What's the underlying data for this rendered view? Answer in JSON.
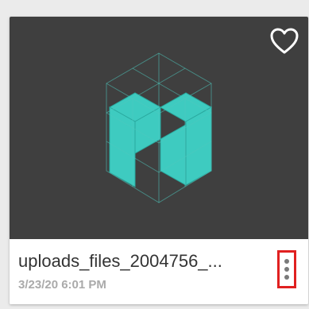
{
  "card": {
    "filename": "uploads_files_2004756_...",
    "date": "3/23/20 6:01 PM",
    "thumbnail_icon": "cube-lattice-logo",
    "favorite_icon": "heart-outline-icon",
    "menu_icon": "more-vertical-icon"
  },
  "colors": {
    "thumbnail_bg": "#3f3f3f",
    "logo_teal": "#3ecbc0",
    "highlight_border": "#e02020"
  }
}
